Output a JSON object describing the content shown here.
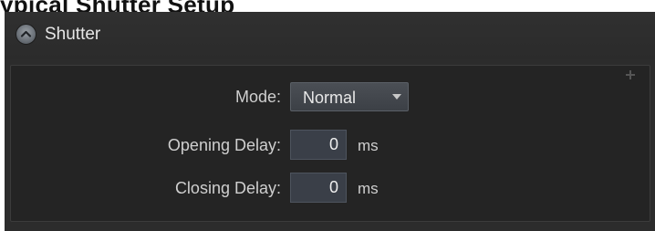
{
  "document_fragment": {
    "text": "ypical Shutter Setup"
  },
  "panel": {
    "title": "Shutter",
    "collapse_icon": "chevron-up-circle-icon",
    "plus_icon": "plus-icon"
  },
  "fields": {
    "mode": {
      "label": "Mode:",
      "value": "Normal",
      "arrow_icon": "dropdown-arrow-icon"
    },
    "opening_delay": {
      "label": "Opening Delay:",
      "value": "0",
      "unit": "ms"
    },
    "closing_delay": {
      "label": "Closing Delay:",
      "value": "0",
      "unit": "ms"
    }
  },
  "colors": {
    "panel_bg": "#2c2c2c",
    "group_bg": "#242424",
    "input_bg": "#3a3f48",
    "text": "#cfcfcf"
  }
}
